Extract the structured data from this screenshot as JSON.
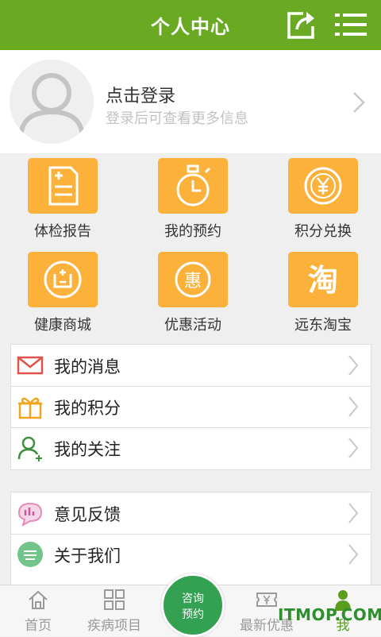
{
  "header": {
    "title": "个人中心",
    "share_icon": "share-icon",
    "menu_icon": "menu-icon"
  },
  "profile": {
    "login_title": "点击登录",
    "login_subtitle": "登录后可查看更多信息",
    "avatar_icon": "avatar-placeholder-icon"
  },
  "grid": {
    "items": [
      {
        "label": "体检报告",
        "icon": "report-icon"
      },
      {
        "label": "我的预约",
        "icon": "timer-icon"
      },
      {
        "label": "积分兑换",
        "icon": "yen-exchange-icon"
      },
      {
        "label": "健康商城",
        "icon": "shop-icon"
      },
      {
        "label": "优惠活动",
        "icon": "discount-icon",
        "glyph": "惠"
      },
      {
        "label": "远东淘宝",
        "icon": "taobao-icon",
        "glyph": "淘"
      }
    ]
  },
  "list_primary": [
    {
      "label": "我的消息",
      "icon": "mail-icon"
    },
    {
      "label": "我的积分",
      "icon": "gift-icon"
    },
    {
      "label": "我的关注",
      "icon": "follow-user-icon"
    }
  ],
  "list_secondary": [
    {
      "label": "意见反馈",
      "icon": "feedback-icon"
    },
    {
      "label": "关于我们",
      "icon": "about-icon"
    }
  ],
  "tabbar": {
    "tabs": [
      {
        "label": "首页",
        "icon": "home-icon",
        "active": false
      },
      {
        "label": "疾病项目",
        "icon": "grid-icon",
        "active": false
      },
      {
        "label": "最新优惠",
        "icon": "coupon-icon",
        "active": false
      },
      {
        "label": "我",
        "icon": "user-icon",
        "active": true
      }
    ],
    "consult_line1": "咨询",
    "consult_line2": "预约"
  },
  "watermark": "ITMOP.COM",
  "colors": {
    "header": "#6aaa23",
    "tile": "#fcb13b",
    "consult": "#33a052"
  }
}
